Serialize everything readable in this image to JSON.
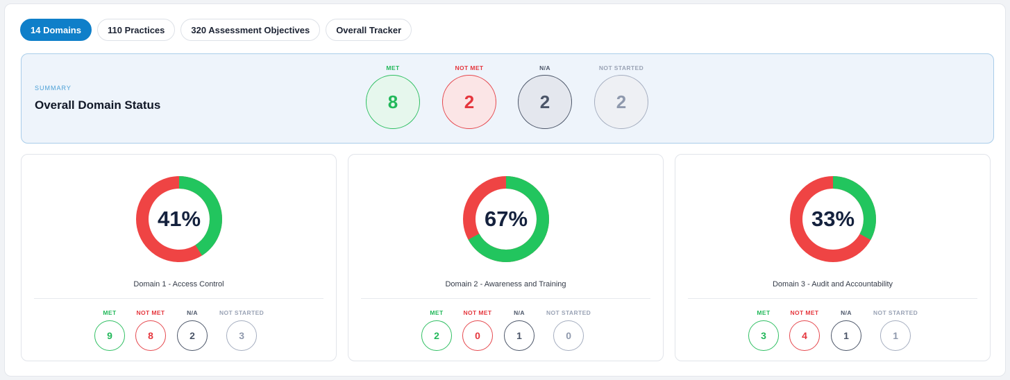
{
  "tabs": [
    {
      "label": "14 Domains",
      "active": true
    },
    {
      "label": "110 Practices",
      "active": false
    },
    {
      "label": "320 Assessment Objectives",
      "active": false
    },
    {
      "label": "Overall Tracker",
      "active": false
    }
  ],
  "summary": {
    "eyebrow": "SUMMARY",
    "title": "Overall Domain Status",
    "met_label": "MET",
    "met_value": "8",
    "not_met_label": "NOT MET",
    "not_met_value": "2",
    "na_label": "N/A",
    "na_value": "2",
    "not_started_label": "NOT STARTED",
    "not_started_value": "2"
  },
  "colors": {
    "accent": "#0f7fc9",
    "met": "#22c55e",
    "not_met": "#ef4444",
    "na": "#4b5568",
    "not_started": "#9aa3b5"
  },
  "domains": [
    {
      "name": "Domain 1 - Access Control",
      "percent_label": "41%",
      "percent": 41,
      "met_label": "MET",
      "met": "9",
      "not_met_label": "NOT MET",
      "not_met": "8",
      "na_label": "N/A",
      "na": "2",
      "not_started_label": "NOT STARTED",
      "not_started": "3"
    },
    {
      "name": "Domain 2 - Awareness and Training",
      "percent_label": "67%",
      "percent": 67,
      "met_label": "MET",
      "met": "2",
      "not_met_label": "NOT MET",
      "not_met": "0",
      "na_label": "N/A",
      "na": "1",
      "not_started_label": "NOT STARTED",
      "not_started": "0"
    },
    {
      "name": "Domain 3 - Audit and Accountability",
      "percent_label": "33%",
      "percent": 33,
      "met_label": "MET",
      "met": "3",
      "not_met_label": "NOT MET",
      "not_met": "4",
      "na_label": "N/A",
      "na": "1",
      "not_started_label": "NOT STARTED",
      "not_started": "1"
    }
  ]
}
